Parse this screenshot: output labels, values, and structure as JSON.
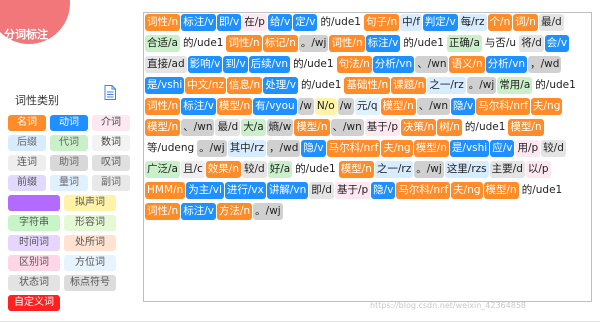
{
  "colors": {
    "noun": "#ff8c28",
    "verb": "#1e90ff",
    "adjective": "#8fe08f",
    "adverb": "#d3d3d3",
    "auxiliary": "#ffd1dc",
    "preposition": "#d7ecff",
    "pronoun": "#cfe8ff",
    "punctuation": "#c8c8c8",
    "conjunction": "#e8e8e8",
    "quantity": "#b0c4de",
    "custom": "#ff2020",
    "white": "#ffffff",
    "text": "#222222"
  },
  "app": {
    "title": "分词标注"
  },
  "legend": {
    "title": "词性类别",
    "doc_icon": "document-icon",
    "rows": [
      [
        {
          "label": "名词",
          "bg": "#ff8c28",
          "fg": "#ffffff"
        },
        {
          "label": "动词",
          "bg": "#1e90ff",
          "fg": "#ffffff"
        },
        {
          "label": "介词",
          "bg": "#fde7f0",
          "fg": "#444444"
        }
      ],
      [
        {
          "label": "后缀",
          "bg": "#d7ecff",
          "fg": "#666666"
        },
        {
          "label": "代词",
          "bg": "#c9f0c9",
          "fg": "#666666"
        },
        {
          "label": "数词",
          "bg": "#f3f3f3",
          "fg": "#444444"
        }
      ],
      [
        {
          "label": "连词",
          "bg": "#eeeeee",
          "fg": "#555555"
        },
        {
          "label": "助词",
          "bg": "#d8d8d8",
          "fg": "#666666"
        },
        {
          "label": "叹词",
          "bg": "#e0e0e0",
          "fg": "#555555"
        }
      ],
      [
        {
          "label": "前缀",
          "bg": "#e2d9ff",
          "fg": "#555555"
        },
        {
          "label": "量词",
          "bg": "#dff0ff",
          "fg": "#666666"
        },
        {
          "label": "副词",
          "bg": "#e8e8e8",
          "fg": "#666666"
        }
      ],
      [
        {
          "label": "",
          "bg": "#b36bff",
          "fg": "#ffffff",
          "wide": true
        },
        {
          "label": "拟声词",
          "bg": "#fff3a8",
          "fg": "#555555",
          "wide": true
        }
      ],
      [
        {
          "label": "字符串",
          "bg": "#c7f5c7",
          "fg": "#555555",
          "wide": true
        },
        {
          "label": "形容词",
          "bg": "#e6f9d5",
          "fg": "#555555",
          "wide": true
        }
      ],
      [
        {
          "label": "时间词",
          "bg": "#e6d6ff",
          "fg": "#555555",
          "wide": true
        },
        {
          "label": "处所词",
          "bg": "#ffe3d0",
          "fg": "#555555",
          "wide": true
        }
      ],
      [
        {
          "label": "区别词",
          "bg": "#ffd6e6",
          "fg": "#555555",
          "wide": true
        },
        {
          "label": "方位词",
          "bg": "#e7f4ff",
          "fg": "#555555",
          "wide": true
        }
      ],
      [
        {
          "label": "状态词",
          "bg": "#e3e3e3",
          "fg": "#555555",
          "wide": true
        },
        {
          "label": "标点符号",
          "bg": "#dcdcdc",
          "fg": "#555555",
          "wide": true
        }
      ],
      [
        {
          "label": "自定义词",
          "bg": "#ff2020",
          "fg": "#ffffff",
          "wide": true
        }
      ]
    ]
  },
  "tokens": [
    {
      "t": "词性/n",
      "c": "n"
    },
    {
      "t": "标注/v",
      "c": "v"
    },
    {
      "t": "即/v",
      "c": "v"
    },
    {
      "t": "在/p",
      "c": "p"
    },
    {
      "t": "给/v",
      "c": "v"
    },
    {
      "t": "定/v",
      "c": "v"
    },
    {
      "t": "的/ude1",
      "c": "u"
    },
    {
      "t": "句子/n",
      "c": "n"
    },
    {
      "t": "中/f",
      "c": "f"
    },
    {
      "t": "判定/v",
      "c": "v"
    },
    {
      "t": "每/rz",
      "c": "r"
    },
    {
      "t": "个/n",
      "c": "n"
    },
    {
      "t": "词/n",
      "c": "n"
    },
    {
      "t": "最/d",
      "c": "d"
    },
    {
      "t": "合适/a",
      "c": "a"
    },
    {
      "t": "的/ude1",
      "c": "u"
    },
    {
      "t": "词性/n",
      "c": "n"
    },
    {
      "t": "标记/n",
      "c": "n"
    },
    {
      "t": "。/wj",
      "c": "w"
    },
    {
      "t": "词性/n",
      "c": "n"
    },
    {
      "t": "标注/v",
      "c": "v"
    },
    {
      "t": "的/ude1",
      "c": "u"
    },
    {
      "t": "正确/a",
      "c": "a"
    },
    {
      "t": "与否/u",
      "c": "u"
    },
    {
      "t": "将/d",
      "c": "d"
    },
    {
      "t": "会/v",
      "c": "v"
    },
    {
      "t": "直接/ad",
      "c": "d"
    },
    {
      "t": "影响/v",
      "c": "v"
    },
    {
      "t": "到/v",
      "c": "v"
    },
    {
      "t": "后续/vn",
      "c": "v"
    },
    {
      "t": "的/ude1",
      "c": "u"
    },
    {
      "t": "句法/n",
      "c": "n"
    },
    {
      "t": "分析/vn",
      "c": "v"
    },
    {
      "t": "、/wn",
      "c": "w"
    },
    {
      "t": "语义/n",
      "c": "n"
    },
    {
      "t": "分析/vn",
      "c": "v"
    },
    {
      "t": "，/wd",
      "c": "w"
    },
    {
      "t": "是/vshi",
      "c": "v"
    },
    {
      "t": "中文/nz",
      "c": "n"
    },
    {
      "t": "信息/n",
      "c": "n"
    },
    {
      "t": "处理/v",
      "c": "v"
    },
    {
      "t": "的/ude1",
      "c": "u"
    },
    {
      "t": "基础性/n",
      "c": "n"
    },
    {
      "t": "课题/n",
      "c": "n"
    },
    {
      "t": "之一/rz",
      "c": "r"
    },
    {
      "t": "。/wj",
      "c": "w"
    },
    {
      "t": "常用/a",
      "c": "a"
    },
    {
      "t": "的/ude1",
      "c": "u"
    },
    {
      "t": "词性/n",
      "c": "n"
    },
    {
      "t": "标注/v",
      "c": "v"
    },
    {
      "t": "模型/n",
      "c": "n"
    },
    {
      "t": "有/vyou",
      "c": "v"
    },
    {
      "t": "/w",
      "c": "w"
    },
    {
      "t": "N/o",
      "c": "o"
    },
    {
      "t": "/w",
      "c": "w"
    },
    {
      "t": "元/q",
      "c": "q"
    },
    {
      "t": "模型/n",
      "c": "n"
    },
    {
      "t": "、/wn",
      "c": "w"
    },
    {
      "t": "隐/v",
      "c": "v"
    },
    {
      "t": "马尔科/nrf",
      "c": "n"
    },
    {
      "t": "夫/ng",
      "c": "n"
    },
    {
      "t": "模型/n",
      "c": "n"
    },
    {
      "t": "、/wn",
      "c": "w"
    },
    {
      "t": "最/d",
      "c": "d"
    },
    {
      "t": "大/a",
      "c": "a"
    },
    {
      "t": "熵/w",
      "c": "w"
    },
    {
      "t": "模型/n",
      "c": "n"
    },
    {
      "t": "、/wn",
      "c": "w"
    },
    {
      "t": "基于/p",
      "c": "p"
    },
    {
      "t": "决策/n",
      "c": "n"
    },
    {
      "t": "树/n",
      "c": "n"
    },
    {
      "t": "的/ude1",
      "c": "u"
    },
    {
      "t": "模型/n",
      "c": "n"
    },
    {
      "t": "等/udeng",
      "c": "u"
    },
    {
      "t": "。/wj",
      "c": "w"
    },
    {
      "t": "其中/rz",
      "c": "r"
    },
    {
      "t": "，/wd",
      "c": "w"
    },
    {
      "t": "隐/v",
      "c": "v"
    },
    {
      "t": "马尔科/nrf",
      "c": "n"
    },
    {
      "t": "夫/ng",
      "c": "n"
    },
    {
      "t": "模型/n",
      "c": "n"
    },
    {
      "t": "是/vshi",
      "c": "v"
    },
    {
      "t": "应/v",
      "c": "v"
    },
    {
      "t": "用/p",
      "c": "p"
    },
    {
      "t": "较/d",
      "c": "d"
    },
    {
      "t": "广泛/a",
      "c": "a"
    },
    {
      "t": "且/c",
      "c": "c"
    },
    {
      "t": "效果/n",
      "c": "n"
    },
    {
      "t": "较/d",
      "c": "d"
    },
    {
      "t": "好/a",
      "c": "a"
    },
    {
      "t": "的/ude1",
      "c": "u"
    },
    {
      "t": "模型/n",
      "c": "n"
    },
    {
      "t": "之一/rz",
      "c": "r"
    },
    {
      "t": "。/wj",
      "c": "w"
    },
    {
      "t": "这里/rzs",
      "c": "r"
    },
    {
      "t": "主要/d",
      "c": "d"
    },
    {
      "t": "以/p",
      "c": "p"
    },
    {
      "t": "HMM/n",
      "c": "n"
    },
    {
      "t": "为主/vl",
      "c": "v"
    },
    {
      "t": "进行/vx",
      "c": "v"
    },
    {
      "t": "讲解/vn",
      "c": "v"
    },
    {
      "t": "即/d",
      "c": "d"
    },
    {
      "t": "基于/p",
      "c": "p"
    },
    {
      "t": "隐/v",
      "c": "v"
    },
    {
      "t": "马尔科/nrf",
      "c": "n"
    },
    {
      "t": "夫/ng",
      "c": "n"
    },
    {
      "t": "模型/n",
      "c": "n"
    },
    {
      "t": "的/ude1",
      "c": "u"
    },
    {
      "t": "词性/n",
      "c": "n"
    },
    {
      "t": "标注/v",
      "c": "v"
    },
    {
      "t": "方法/n",
      "c": "n"
    },
    {
      "t": "。/wj",
      "c": "w"
    }
  ],
  "watermark": "https://blog.csdn.net/weixin_42364858"
}
